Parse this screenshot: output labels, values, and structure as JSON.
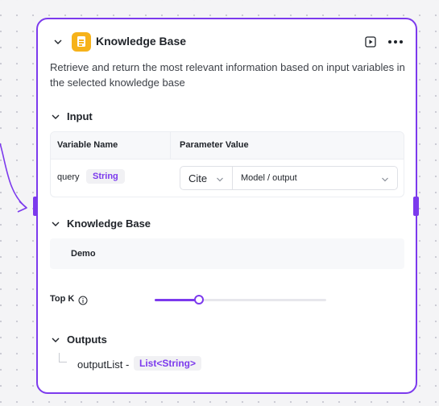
{
  "node": {
    "title": "Knowledge Base",
    "description": "Retrieve and return the most relevant information based on input variables in the selected knowledge base",
    "colors": {
      "accent": "#7c3aed",
      "icon_bg": "#f6b21a"
    },
    "icons": {
      "collapse": "chevron-down-icon",
      "node": "knowledge-base-icon",
      "run": "play-icon",
      "more": "more-icon"
    }
  },
  "input": {
    "label": "Input",
    "columns": [
      "Variable Name",
      "Parameter Value"
    ],
    "rows": [
      {
        "name": "query",
        "type": "String",
        "mode": "Cite",
        "value": "Model / output"
      }
    ]
  },
  "knowledge_base": {
    "label": "Knowledge Base",
    "items": [
      "Demo"
    ]
  },
  "top_k": {
    "label": "Top K",
    "slider_fraction": 0.26
  },
  "outputs": {
    "label": "Outputs",
    "items": [
      {
        "name": "outputList",
        "separator": "-",
        "type": "List<String>"
      }
    ]
  }
}
